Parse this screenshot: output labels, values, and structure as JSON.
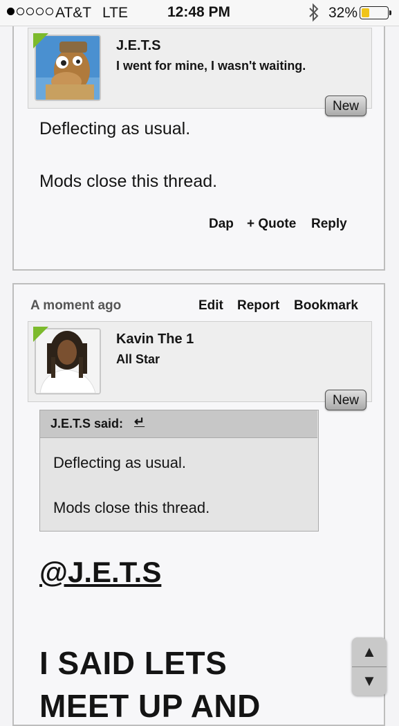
{
  "status_bar": {
    "carrier": "AT&T",
    "network": "LTE",
    "time": "12:48 PM",
    "battery_percent": "32%",
    "battery_level": 0.32,
    "signal_bars": 1,
    "signal_total": 5,
    "battery_color": "#f0c419"
  },
  "post1": {
    "author_name": "J.E.T.S",
    "author_title": "I went for mine, I wasn't waiting.",
    "badge": "New",
    "message_lines": [
      "Deflecting as usual.",
      "Mods close this thread."
    ],
    "actions": {
      "dap": "Dap",
      "quote": "+ Quote",
      "reply": "Reply"
    }
  },
  "post2": {
    "timestamp": "A moment ago",
    "actions": {
      "edit": "Edit",
      "report": "Report",
      "bookmark": "Bookmark"
    },
    "author_name": "Kavin The 1",
    "author_title": "All Star",
    "badge": "New",
    "quote": {
      "header": "J.E.T.S said:",
      "jump_icon": "↵",
      "lines": [
        "Deflecting as usual.",
        "Mods close this thread."
      ]
    },
    "mention": "@J.E.T.S",
    "body_lines": [
      "I SAID LETS",
      "MEET UP AND"
    ]
  },
  "scroll_widget": {
    "up_icon": "▲",
    "down_icon": "▼"
  },
  "colors": {
    "accent_tab": "#7cba2c",
    "post_border": "#bdbdbd"
  }
}
